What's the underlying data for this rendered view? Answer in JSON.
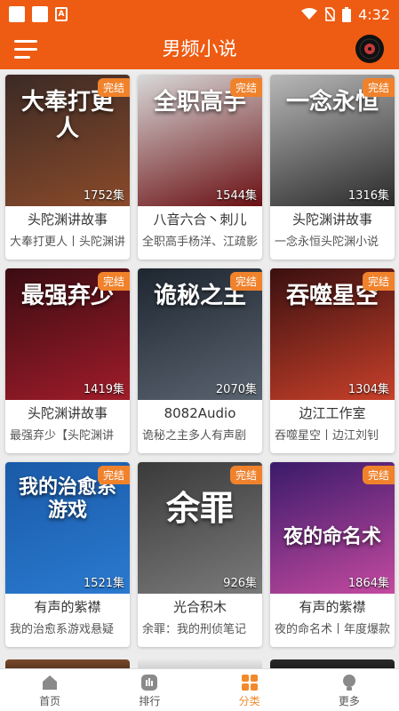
{
  "status_bar": {
    "time": "4:32"
  },
  "header": {
    "title": "男频小说"
  },
  "colors": {
    "accent": "#ee5b12",
    "badge": "#f0822c",
    "active_tab": "#f28a2b"
  },
  "books": [
    {
      "cover_title": "大奉打更人",
      "badge": "完结",
      "episodes": "1752集",
      "narrator": "头陀渊讲故事",
      "desc": "大奉打更人丨头陀渊讲",
      "cover_colors": [
        "#3b2a25",
        "#8a4a2a"
      ]
    },
    {
      "cover_title": "全职高手",
      "badge": "完结",
      "episodes": "1544集",
      "narrator": "八音六合丶刺儿",
      "desc": "全职高手杨洋、江疏影",
      "cover_colors": [
        "#d8d8d8",
        "#6a0f12"
      ]
    },
    {
      "cover_title": "一念永恒",
      "badge": "完结",
      "episodes": "1316集",
      "narrator": "头陀渊讲故事",
      "desc": "一念永恒头陀渊小说",
      "cover_colors": [
        "#b8b8b8",
        "#2a2a2a"
      ]
    },
    {
      "cover_title": "最强弃少",
      "badge": "完结",
      "episodes": "1419集",
      "narrator": "头陀渊讲故事",
      "desc": "最强弃少【头陀渊讲",
      "cover_colors": [
        "#3a0c12",
        "#a01c2a"
      ]
    },
    {
      "cover_title": "诡秘之主",
      "badge": "完结",
      "episodes": "2070集",
      "narrator": "8082Audio",
      "desc": "诡秘之主多人有声剧",
      "cover_colors": [
        "#1e2630",
        "#5a6470"
      ]
    },
    {
      "cover_title": "吞噬星空",
      "badge": "完结",
      "episodes": "1304集",
      "narrator": "边江工作室",
      "desc": "吞噬星空丨边江刘钊",
      "cover_colors": [
        "#3a1010",
        "#c8402a"
      ]
    },
    {
      "cover_title": "我的治愈系游戏",
      "badge": "完结",
      "episodes": "1521集",
      "narrator": "有声的紫襟",
      "desc": "我的治愈系游戏悬疑",
      "cover_colors": [
        "#1a5aa8",
        "#2a7ad0"
      ]
    },
    {
      "cover_title": "余罪",
      "badge": "完结",
      "episodes": "926集",
      "narrator": "光合积木",
      "desc": "余罪：我的刑侦笔记",
      "cover_colors": [
        "#3a3a3a",
        "#7a7a7a"
      ]
    },
    {
      "cover_title": "夜的命名术",
      "badge": "完结",
      "episodes": "1864集",
      "narrator": "有声的紫襟",
      "desc": "夜的命名术丨年度爆款",
      "cover_colors": [
        "#3a1a6a",
        "#c44aa0"
      ]
    }
  ],
  "tabs": [
    {
      "label": "首页",
      "icon": "home-icon"
    },
    {
      "label": "排行",
      "icon": "ranking-icon"
    },
    {
      "label": "分类",
      "icon": "category-icon",
      "active": true
    },
    {
      "label": "更多",
      "icon": "more-icon"
    }
  ]
}
